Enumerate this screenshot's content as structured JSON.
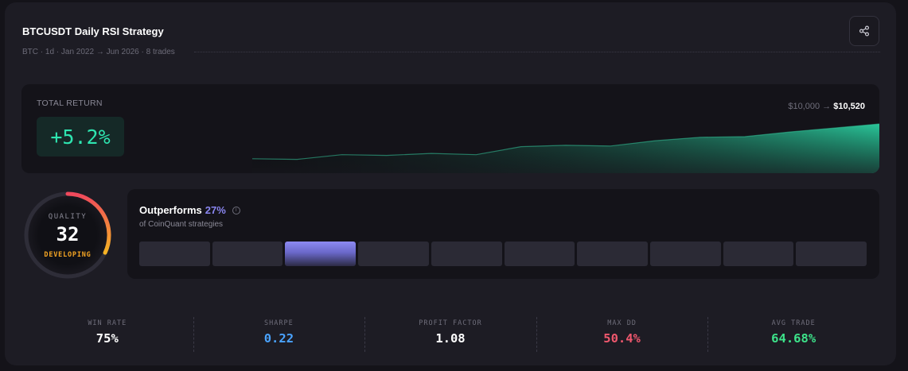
{
  "header": {
    "title": "BTCUSDT Daily RSI Strategy",
    "subtitle": "BTC · 1d · Jan 2022 → Jun 2026 · 8 trades",
    "share_icon": "share-icon"
  },
  "total_return": {
    "label": "TOTAL RETURN",
    "value": "+5.2%",
    "start_balance": "$10,000",
    "arrow": "→",
    "end_balance": "$10,520"
  },
  "equity_curve": {
    "color": "#2ee5b0",
    "values": [
      10000,
      9990,
      10060,
      10050,
      10080,
      10060,
      10180,
      10200,
      10190,
      10270,
      10320,
      10330,
      10400,
      10460,
      10520
    ]
  },
  "quality": {
    "label": "QUALITY",
    "score": "32",
    "score_fraction": 0.32,
    "status": "DEVELOPING",
    "status_color": "#f5a524"
  },
  "outperforms": {
    "title": "Outperforms",
    "percent": "27%",
    "subtitle": "of CoinQuant strategies",
    "bin_count": 10,
    "active_bin": 2,
    "accent": "#8a86f0"
  },
  "stats": [
    {
      "label": "WIN RATE",
      "value": "75%",
      "color": "#ffffff"
    },
    {
      "label": "SHARPE",
      "value": "0.22",
      "color": "#4aa3ff"
    },
    {
      "label": "PROFIT FACTOR",
      "value": "1.08",
      "color": "#ffffff"
    },
    {
      "label": "MAX DD",
      "value": "50.4%",
      "color": "#f0586e"
    },
    {
      "label": "AVG TRADE",
      "value": "64.68%",
      "color": "#3de38a"
    }
  ]
}
